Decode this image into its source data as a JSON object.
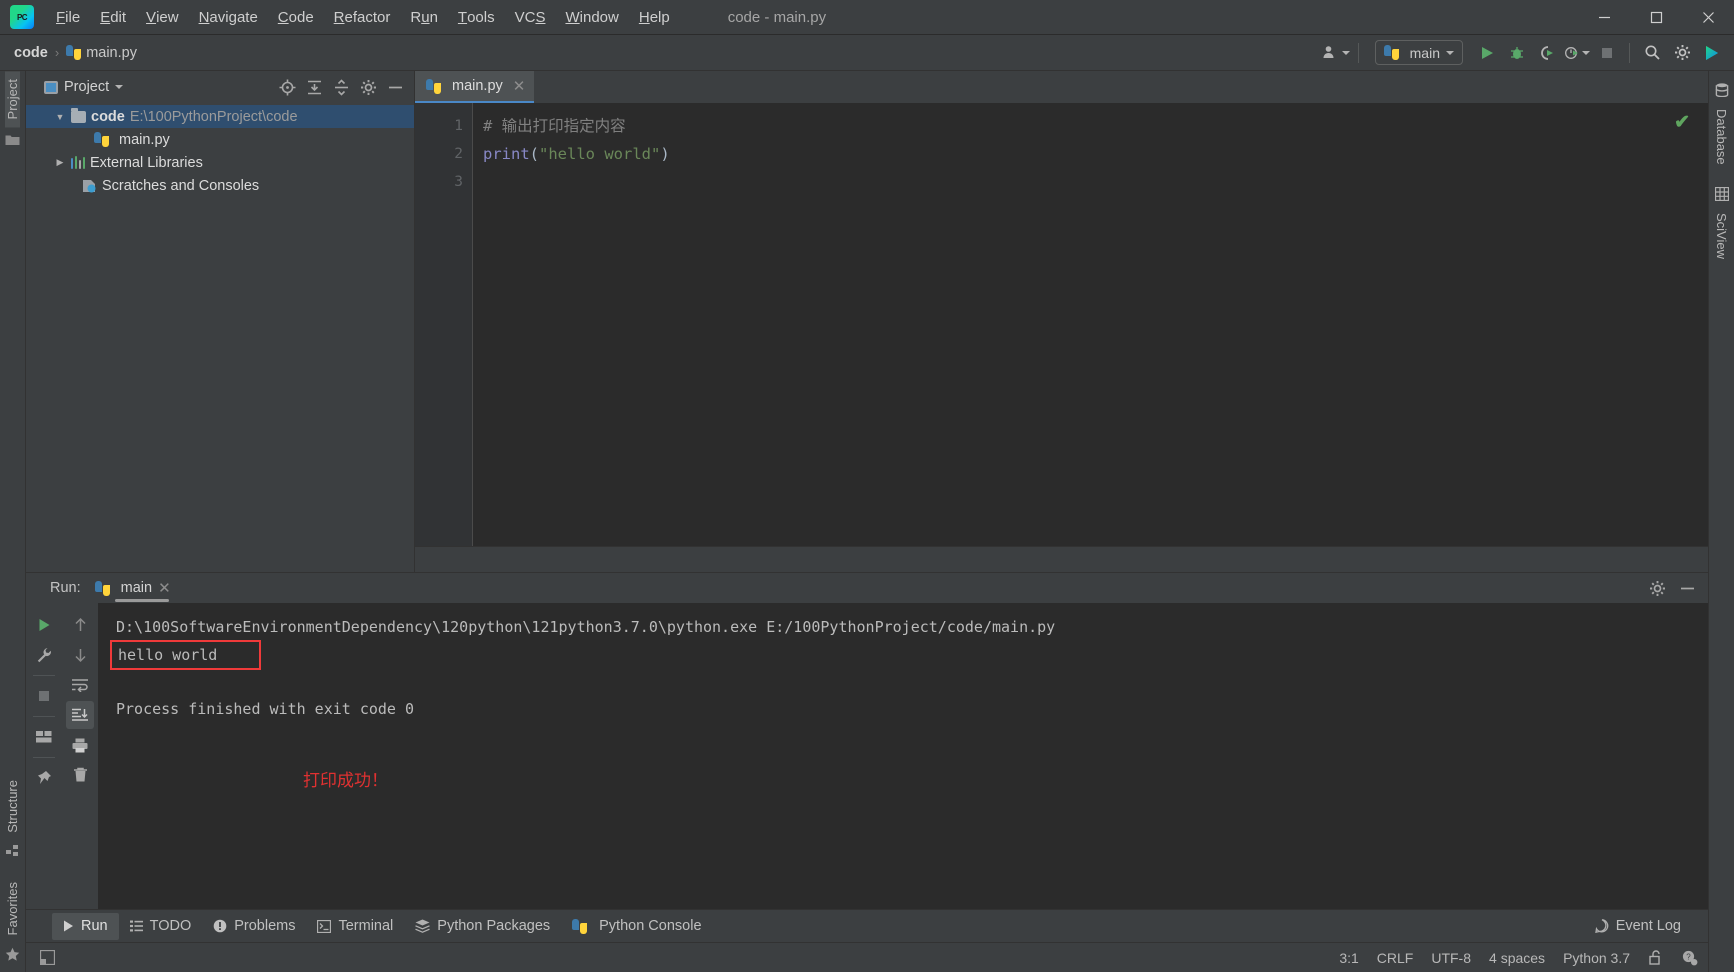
{
  "window": {
    "title": "code - main.py",
    "app_icon": "pycharm-logo",
    "logo_text": "PC",
    "minimize_label": "─",
    "maximize_label": "☐",
    "close_label": "✕"
  },
  "menu": {
    "items": [
      {
        "label": "File",
        "mnemonic": "F"
      },
      {
        "label": "Edit",
        "mnemonic": "E"
      },
      {
        "label": "View",
        "mnemonic": "V"
      },
      {
        "label": "Navigate",
        "mnemonic": "N"
      },
      {
        "label": "Code",
        "mnemonic": "C"
      },
      {
        "label": "Refactor",
        "mnemonic": "R"
      },
      {
        "label": "Run",
        "mnemonic": "u"
      },
      {
        "label": "Tools",
        "mnemonic": "T"
      },
      {
        "label": "VCS",
        "mnemonic": "S"
      },
      {
        "label": "Window",
        "mnemonic": "W"
      },
      {
        "label": "Help",
        "mnemonic": "H"
      }
    ]
  },
  "navbar": {
    "breadcrumb": {
      "project": "code",
      "separator": "›",
      "file": "main.py",
      "file_icon": "python-file-icon"
    },
    "run_config": {
      "name": "main",
      "icon": "python-icon",
      "dropdown_icon": "chevron-down-icon"
    },
    "buttons": [
      {
        "name": "user-account-icon",
        "label": ""
      },
      {
        "name": "run-button",
        "label": ""
      },
      {
        "name": "debug-button",
        "label": ""
      },
      {
        "name": "run-coverage-button",
        "label": ""
      },
      {
        "name": "profiler-button",
        "label": ""
      },
      {
        "name": "stop-button",
        "label": ""
      },
      {
        "name": "search-everywhere-button",
        "label": ""
      },
      {
        "name": "settings-button",
        "label": ""
      },
      {
        "name": "updates-button",
        "label": ""
      }
    ]
  },
  "left_sidebar": {
    "tabs": [
      {
        "label": "Project",
        "icon": "project-icon",
        "active": true
      },
      {
        "label": "Structure",
        "icon": "structure-icon",
        "active": false
      },
      {
        "label": "Favorites",
        "icon": "star-icon",
        "active": false
      }
    ]
  },
  "right_sidebar": {
    "tabs": [
      {
        "label": "Database",
        "icon": "database-icon"
      },
      {
        "label": "SciView",
        "icon": "grid-icon"
      }
    ]
  },
  "project_panel": {
    "title": "Project",
    "title_icon": "project-view-icon",
    "dropdown_icon": "chevron-down-icon",
    "actions": [
      {
        "name": "locate-file-icon"
      },
      {
        "name": "expand-all-icon"
      },
      {
        "name": "collapse-all-icon"
      },
      {
        "name": "gear-icon"
      },
      {
        "name": "hide-icon"
      }
    ],
    "tree": [
      {
        "name": "code",
        "path": "E:\\100PythonProject\\code",
        "type": "folder",
        "expanded": true,
        "selected": true,
        "indent": 0
      },
      {
        "name": "main.py",
        "path": "",
        "type": "python-file",
        "expanded": false,
        "selected": false,
        "indent": 1
      },
      {
        "name": "External Libraries",
        "path": "",
        "type": "library",
        "expanded": false,
        "selected": false,
        "indent": 0
      },
      {
        "name": "Scratches and Consoles",
        "path": "",
        "type": "scratch",
        "expanded": false,
        "selected": false,
        "indent": 0
      }
    ]
  },
  "editor": {
    "tabs": [
      {
        "label": "main.py",
        "icon": "python-file-icon",
        "close_label": "✕",
        "active": true
      }
    ],
    "line_numbers": [
      "1",
      "2",
      "3"
    ],
    "lines": [
      {
        "parts": [
          {
            "text": "# 输出打印指定内容",
            "cls": "cmt"
          }
        ]
      },
      {
        "parts": [
          {
            "text": "print",
            "cls": "kw"
          },
          {
            "text": "(",
            "cls": "pun"
          },
          {
            "text": "\"hello world\"",
            "cls": "str"
          },
          {
            "text": ")",
            "cls": "pun"
          }
        ]
      },
      {
        "parts": [
          {
            "text": "",
            "cls": "pun"
          }
        ]
      }
    ],
    "inspection_status": "✔"
  },
  "run_panel": {
    "label": "Run:",
    "tab": {
      "label": "main",
      "icon": "python-icon",
      "close_label": "✕"
    },
    "header_actions": [
      {
        "name": "gear-icon"
      },
      {
        "name": "hide-icon"
      }
    ],
    "toolbar_left": [
      {
        "name": "rerun-button",
        "icon": "play-icon"
      },
      {
        "name": "run-settings-button",
        "icon": "wrench-icon"
      },
      {
        "name": "stop-button",
        "icon": "stop-icon"
      },
      {
        "name": "layout-button",
        "icon": "layout-icon"
      },
      {
        "name": "pin-button",
        "icon": "pin-icon"
      }
    ],
    "toolbar_right": [
      {
        "name": "up-button",
        "icon": "arrow-up-icon"
      },
      {
        "name": "down-button",
        "icon": "arrow-down-icon"
      },
      {
        "name": "soft-wrap-button",
        "icon": "wrap-icon"
      },
      {
        "name": "scroll-to-end-button",
        "icon": "scroll-end-icon",
        "active": true
      },
      {
        "name": "print-button",
        "icon": "printer-icon"
      },
      {
        "name": "clear-all-button",
        "icon": "trash-icon"
      }
    ],
    "console": {
      "command": "D:\\100SoftwareEnvironmentDependency\\120python\\121python3.7.0\\python.exe E:/100PythonProject/code/main.py",
      "output": "hello world",
      "blank": "",
      "exit_line": "Process finished with exit code 0"
    },
    "annotation": "打印成功！",
    "annotation_color": "#e03131",
    "highlight_color": "#f03a3a"
  },
  "tool_windows": {
    "tabs": [
      {
        "label": "Run",
        "icon": "play-icon",
        "active": true
      },
      {
        "label": "TODO",
        "icon": "list-icon",
        "active": false
      },
      {
        "label": "Problems",
        "icon": "warning-icon",
        "active": false
      },
      {
        "label": "Terminal",
        "icon": "terminal-icon",
        "active": false
      },
      {
        "label": "Python Packages",
        "icon": "packages-icon",
        "active": false
      },
      {
        "label": "Python Console",
        "icon": "python-icon",
        "active": false
      }
    ],
    "event_log": {
      "label": "Event Log",
      "icon": "balloon-icon"
    }
  },
  "status_bar": {
    "caret_position": "3:1",
    "line_separator": "CRLF",
    "encoding": "UTF-8",
    "indent": "4 spaces",
    "interpreter": "Python 3.7",
    "lock_icon": "unlock-icon",
    "notification_icon": "help-gear-icon"
  }
}
